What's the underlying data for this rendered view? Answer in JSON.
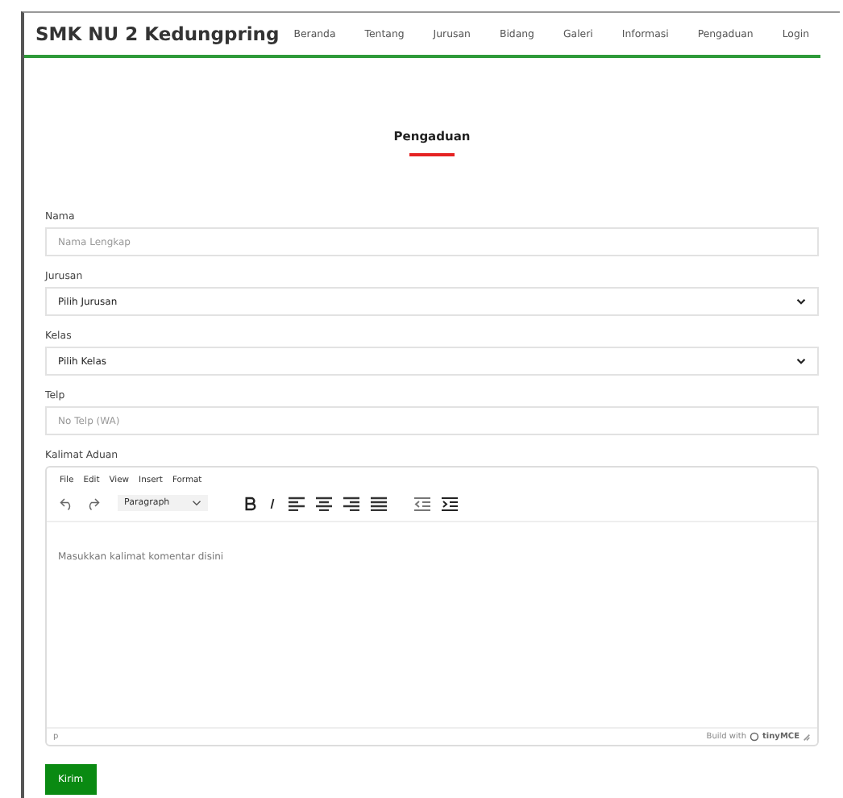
{
  "navbar": {
    "brand": "SMK NU 2 Kedungpring",
    "links": [
      "Beranda",
      "Tentang",
      "Jurusan",
      "Bidang",
      "Galeri",
      "Informasi",
      "Pengaduan",
      "Login"
    ]
  },
  "page_title": "Pengaduan",
  "form": {
    "fields": [
      {
        "kind": "input",
        "label": "Nama",
        "placeholder": "Nama Lengkap"
      },
      {
        "kind": "select",
        "label": "Jurusan",
        "value": "Pilih Jurusan"
      },
      {
        "kind": "select",
        "label": "Kelas",
        "value": "Pilih Kelas"
      },
      {
        "kind": "input",
        "label": "Telp",
        "placeholder": "No Telp (WA)"
      }
    ],
    "editor": {
      "label": "Kalimat Aduan",
      "menu": [
        "File",
        "Edit",
        "View",
        "Insert",
        "Format"
      ],
      "block_format": "Paragraph",
      "placeholder": "Masukkan kalimat komentar disini",
      "status_path": "p",
      "branding_prefix": "Build with",
      "branding": "tinyMCE"
    },
    "submit": "Kirim"
  }
}
